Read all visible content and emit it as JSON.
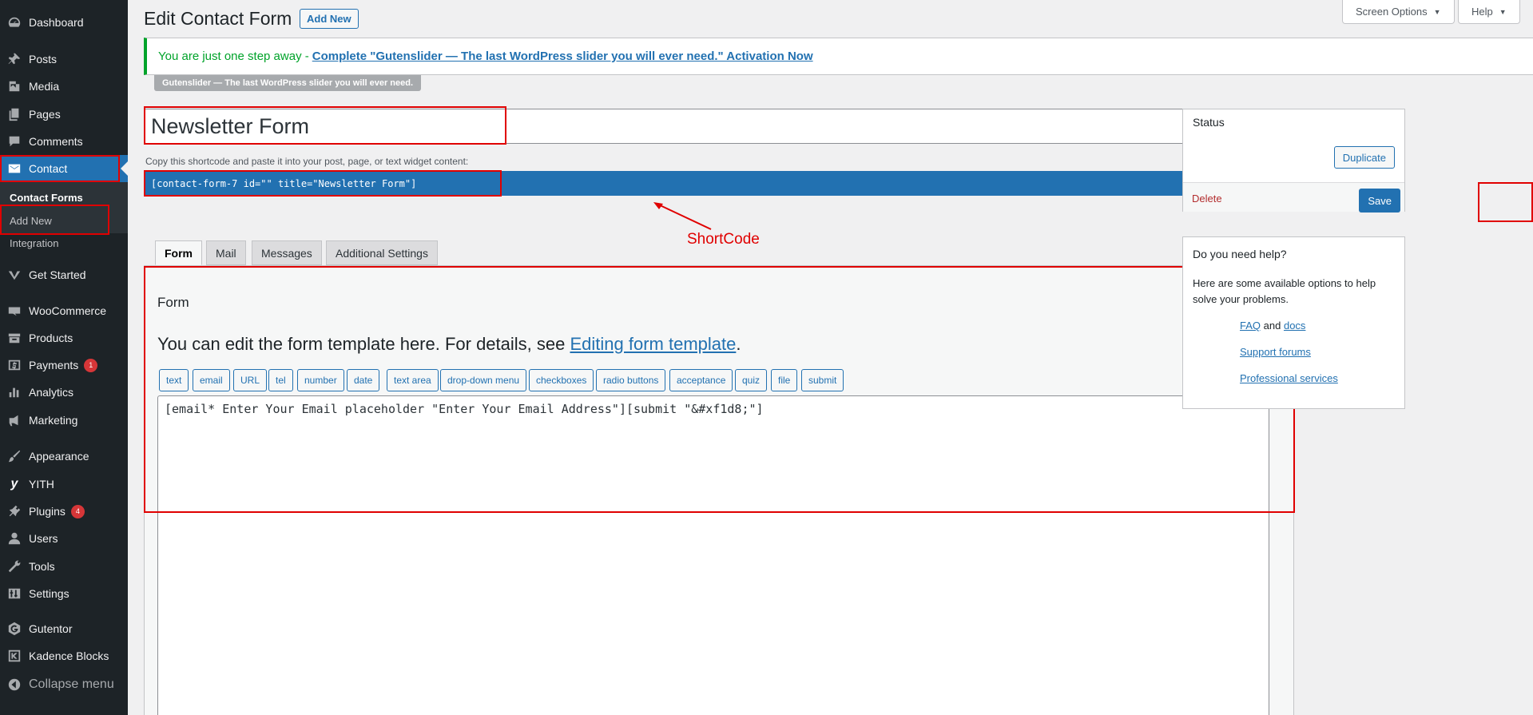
{
  "sidebar": {
    "items": [
      {
        "label": "Dashboard",
        "icon": "dashboard-icon"
      },
      {
        "label": "Posts",
        "icon": "pushpin-icon"
      },
      {
        "label": "Media",
        "icon": "media-icon"
      },
      {
        "label": "Pages",
        "icon": "pages-icon"
      },
      {
        "label": "Comments",
        "icon": "comment-icon"
      },
      {
        "label": "Contact",
        "icon": "envelope-icon"
      },
      {
        "label": "Get Started",
        "icon": "checkmark-v-icon"
      },
      {
        "label": "WooCommerce",
        "icon": "woo-icon"
      },
      {
        "label": "Products",
        "icon": "archive-icon"
      },
      {
        "label": "Payments",
        "icon": "dollar-icon",
        "badge": "1"
      },
      {
        "label": "Analytics",
        "icon": "bar-chart-icon"
      },
      {
        "label": "Marketing",
        "icon": "megaphone-icon"
      },
      {
        "label": "Appearance",
        "icon": "paintbrush-icon"
      },
      {
        "label": "YITH",
        "icon": "yith-icon"
      },
      {
        "label": "Plugins",
        "icon": "plug-icon",
        "badge": "4"
      },
      {
        "label": "Users",
        "icon": "user-icon"
      },
      {
        "label": "Tools",
        "icon": "wrench-icon"
      },
      {
        "label": "Settings",
        "icon": "sliders-icon"
      },
      {
        "label": "Gutentor",
        "icon": "gutentor-icon"
      },
      {
        "label": "Kadence Blocks",
        "icon": "kadence-icon"
      },
      {
        "label": "Collapse menu",
        "icon": "collapse-icon"
      }
    ],
    "submenu": [
      "Contact Forms",
      "Add New",
      "Integration"
    ]
  },
  "header": {
    "title": "Edit Contact Form",
    "add_new": "Add New",
    "screen_options": "Screen Options",
    "help": "Help"
  },
  "notice": {
    "text": "You are just one step away -",
    "link": "Complete \"Gutenslider — The last WordPress slider you will ever need.\" Activation Now",
    "tag": "Gutenslider — The last WordPress slider you will ever need."
  },
  "form": {
    "title": "Newsletter Form",
    "shortcode_label": "Copy this shortcode and paste it into your post, page, or text widget content:",
    "shortcode": "[contact-form-7 id=\"\" title=\"Newsletter Form\"]",
    "annotation": "ShortCode"
  },
  "tabs": [
    "Form",
    "Mail",
    "Messages",
    "Additional Settings"
  ],
  "panel": {
    "heading": "Form",
    "desc": "You can edit the form template here. For details, see ",
    "desc_link": "Editing form template",
    "desc_end": ".",
    "tag_buttons": [
      "text",
      "email",
      "URL",
      "tel",
      "number",
      "date",
      "text area",
      "drop-down menu",
      "checkboxes",
      "radio buttons",
      "acceptance",
      "quiz",
      "file",
      "submit"
    ],
    "editor_content": "[email* Enter Your Email placeholder \"Enter Your Email Address\"][submit \"&#xf1d8;\"]"
  },
  "status": {
    "title": "Status",
    "duplicate": "Duplicate",
    "delete": "Delete",
    "save": "Save"
  },
  "help": {
    "title": "Do you need help?",
    "text": "Here are some available options to help solve your problems.",
    "faq": "FAQ",
    "and": "and",
    "docs": "docs",
    "support": "Support forums",
    "professional": "Professional services"
  },
  "colors": {
    "admin_bar": "#1d2327",
    "accent": "#2271b1",
    "annotation": "#e00000",
    "notice_green": "#00a32a"
  }
}
